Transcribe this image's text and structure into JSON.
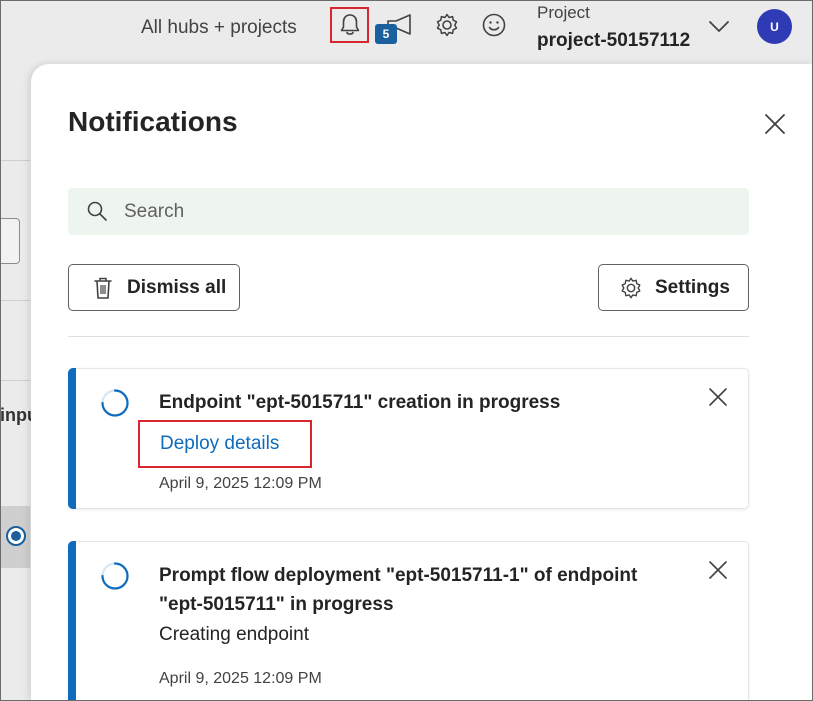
{
  "topbar": {
    "hub_link": "All hubs + projects",
    "notification_count": "5",
    "project_label": "Project",
    "project_name": "project-50157112",
    "avatar_initials": "U"
  },
  "background": {
    "partial_text": "inpu"
  },
  "panel": {
    "title": "Notifications",
    "search_placeholder": "Search",
    "dismiss_all_label": "Dismiss all",
    "settings_label": "Settings"
  },
  "notifications": [
    {
      "title": "Endpoint \"ept-5015711\" creation in progress",
      "link": "Deploy details",
      "timestamp": "April 9, 2025 12:09 PM"
    },
    {
      "title": "Prompt flow deployment \"ept-5015711-1\" of endpoint \"ept-5015711\" in progress",
      "body": "Creating endpoint",
      "timestamp": "April 9, 2025 12:09 PM"
    }
  ],
  "colors": {
    "accent": "#0f6cbd",
    "highlight": "#d7262d",
    "badge": "#1a5f9e",
    "avatar": "#2e3bb5",
    "search_bg": "#eef5ee"
  }
}
